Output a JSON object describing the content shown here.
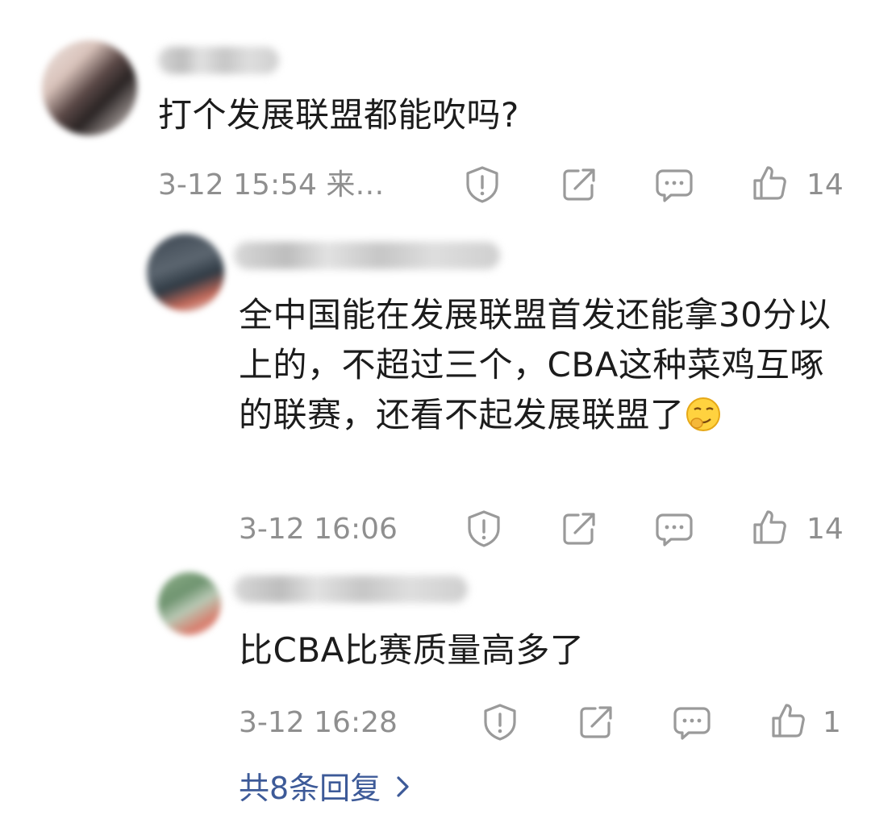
{
  "comments": [
    {
      "text": "打个发展联盟都能吹吗?",
      "meta": "3-12 15:54  来…",
      "likes": "14"
    },
    {
      "text": "全中国能在发展联盟首发还能拿30分以上的，不超过三个，CBA这种菜鸡互啄的联赛，还看不起发展联盟了",
      "meta": "3-12 16:06",
      "likes": "14"
    },
    {
      "text": "比CBA比赛质量高多了",
      "meta": "3-12 16:28",
      "likes": "1"
    }
  ],
  "replies_link": "共8条回复",
  "icons": [
    "report-icon",
    "share-icon",
    "comment-icon",
    "like-icon",
    "chevron-right-icon",
    "smirk-emoji"
  ],
  "colors": {
    "link": "#3d5a98",
    "meta": "#8f8f8f"
  }
}
